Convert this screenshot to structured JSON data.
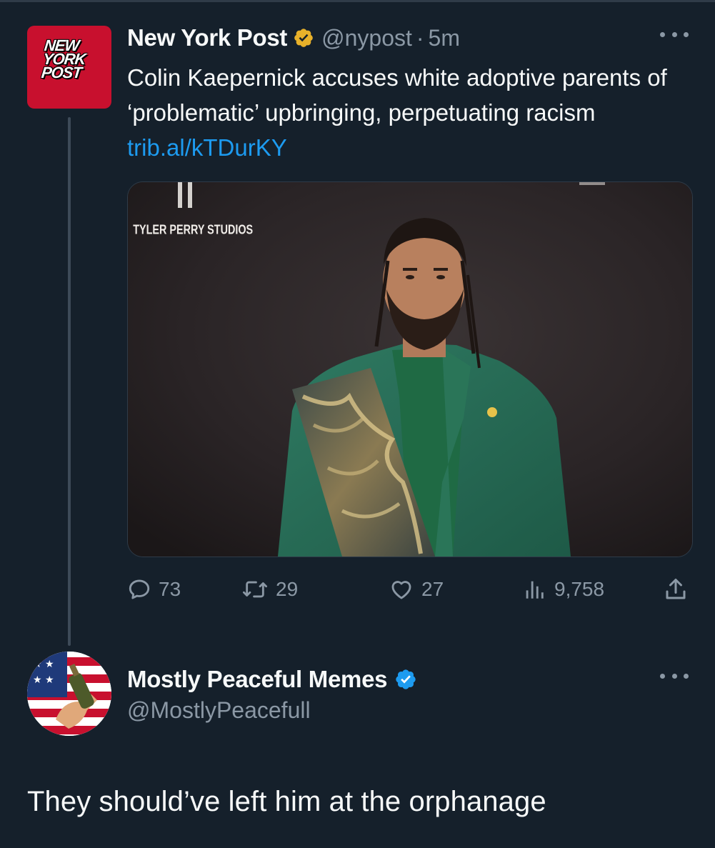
{
  "tweet1": {
    "avatar_logo": [
      "NEW",
      "YORK",
      "POST"
    ],
    "display_name": "New York Post",
    "verified_badge": "gold-verified-icon",
    "handle": "@nypost",
    "separator": "·",
    "time": "5m",
    "text": "Colin Kaepernick accuses white adoptive parents of ‘problematic’ upbringing, perpetuating racism ",
    "link": "trib.al/kTDurKY",
    "media": {
      "backdrop_text": "TYLER PERRY STUDIOS"
    },
    "stats": {
      "replies": "73",
      "retweets": "29",
      "likes": "27",
      "views": "9,758"
    }
  },
  "tweet2": {
    "display_name": "Mostly Peaceful Memes",
    "verified_badge": "blue-verified-icon",
    "handle": "@MostlyPeacefull",
    "text": "They should’ve left him at the orphanage"
  },
  "colors": {
    "background": "#15202b",
    "link": "#1d9bf0",
    "secondary_text": "#8b98a5",
    "primary_text": "#f7f9f9",
    "nyp_red": "#c8102e",
    "gold_badge": "#e8b12a",
    "blue_badge": "#1d9bf0"
  }
}
